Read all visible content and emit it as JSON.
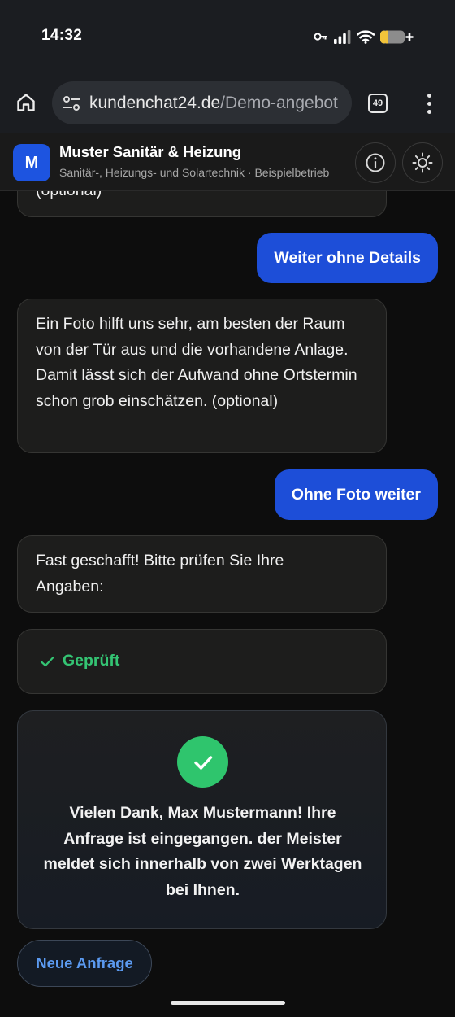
{
  "status_bar": {
    "time": "14:32"
  },
  "browser": {
    "url_domain": "kundenchat24.de",
    "url_path": "/Demo-angebot",
    "tab_count": "49"
  },
  "header": {
    "logo_letter": "M",
    "company_name": "Muster Sanitär & Heizung",
    "company_subtitle": "Sanitär-, Heizungs- und Solartechnik · Beispielbetrieb"
  },
  "chat": {
    "messages": [
      {
        "role": "bot",
        "text": "(optional)"
      },
      {
        "role": "user",
        "text": "Weiter ohne Details"
      },
      {
        "role": "bot",
        "text": "Ein Foto hilft uns sehr, am besten der Raum von der Tür aus und die vorhandene Anlage. Damit lässt sich der Aufwand ohne Ortstermin schon grob einschätzen. (optional)"
      },
      {
        "role": "user",
        "text": "Ohne Foto weiter"
      },
      {
        "role": "bot",
        "text": "Fast geschafft! Bitte prüfen Sie Ihre Angaben:"
      }
    ],
    "verified_label": "Geprüft",
    "success_message": "Vielen Dank, Max Mustermann! Ihre Anfrage ist eingegangen. der Meister meldet sich innerhalb von zwei Werktagen bei Ihnen.",
    "new_request_label": "Neue Anfrage"
  },
  "icons": {
    "home": "home-icon",
    "site_settings": "tune-icon",
    "tabs": "tab-switcher-icon",
    "menu": "more-vert-icon",
    "info": "info-icon",
    "theme": "sun-icon",
    "verified": "check-icon",
    "success": "check-circle-icon",
    "status": [
      "vpn-key-icon",
      "signal-icon",
      "wifi-icon",
      "battery-icon"
    ]
  },
  "colors": {
    "accent": "#1d4ed8",
    "logo": "#1d54e0",
    "success": "#2fc56d",
    "verified_text": "#34c473",
    "link": "#5b9af0",
    "background": "#0d0d0d"
  },
  "battery_level": 0.3
}
